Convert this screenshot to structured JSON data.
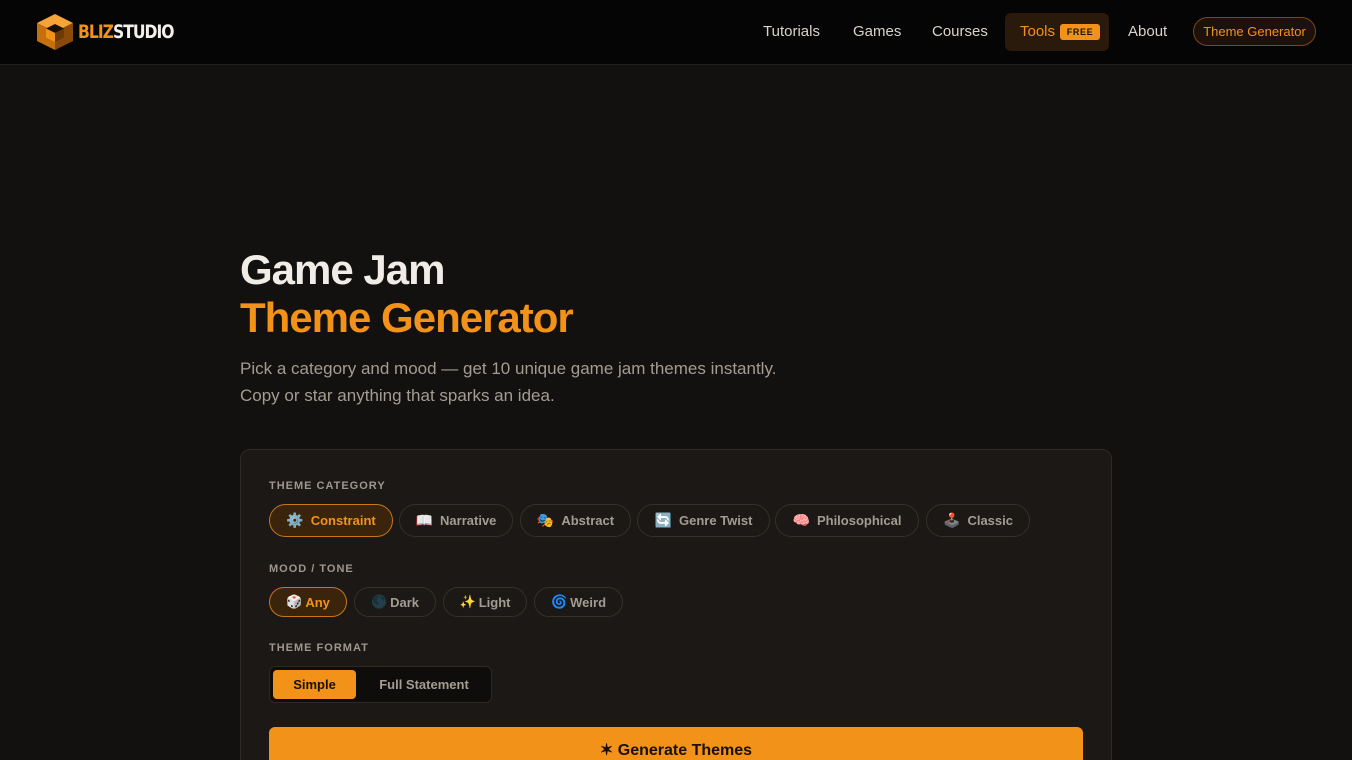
{
  "brand": {
    "logo_a": "BLIZ",
    "logo_b": "STUDIO",
    "accent": "#f39219"
  },
  "nav": {
    "links": [
      "Tutorials",
      "Games",
      "Courses",
      "Tools",
      "About"
    ],
    "tools_badge": "FREE",
    "cta": "Theme Generator"
  },
  "hero": {
    "title_line1": "Game Jam",
    "title_line2": "Theme Generator",
    "subtitle_line1": "Pick a category and mood — get 10 unique game jam themes instantly.",
    "subtitle_line2": "Copy or star anything that sparks an idea."
  },
  "panel": {
    "category_label": "THEME CATEGORY",
    "categories": [
      {
        "icon": "⚙️",
        "icon_name": "gear-icon",
        "label": "Constraint",
        "selected": true
      },
      {
        "icon": "📖",
        "icon_name": "book-icon",
        "label": "Narrative",
        "selected": false
      },
      {
        "icon": "🎭",
        "icon_name": "masks-icon",
        "label": "Abstract",
        "selected": false
      },
      {
        "icon": "🔄",
        "icon_name": "cycle-icon",
        "label": "Genre Twist",
        "selected": false
      },
      {
        "icon": "🧠",
        "icon_name": "brain-icon",
        "label": "Philosophical",
        "selected": false
      },
      {
        "icon": "🕹️",
        "icon_name": "joystick-icon",
        "label": "Classic",
        "selected": false
      }
    ],
    "mood_label": "MOOD / TONE",
    "moods": [
      {
        "icon": "🎲",
        "icon_name": "dice-icon",
        "label": "Any",
        "selected": true
      },
      {
        "icon": "🌑",
        "icon_name": "new-moon-icon",
        "label": "Dark",
        "selected": false
      },
      {
        "icon": "✨",
        "icon_name": "sparkles-icon",
        "label": "Light",
        "selected": false
      },
      {
        "icon": "🌀",
        "icon_name": "spiral-icon",
        "label": "Weird",
        "selected": false
      }
    ],
    "format_label": "THEME FORMAT",
    "formats": [
      {
        "label": "Simple",
        "selected": true
      },
      {
        "label": "Full Statement",
        "selected": false
      }
    ],
    "generate_button": "✶ Generate Themes"
  }
}
